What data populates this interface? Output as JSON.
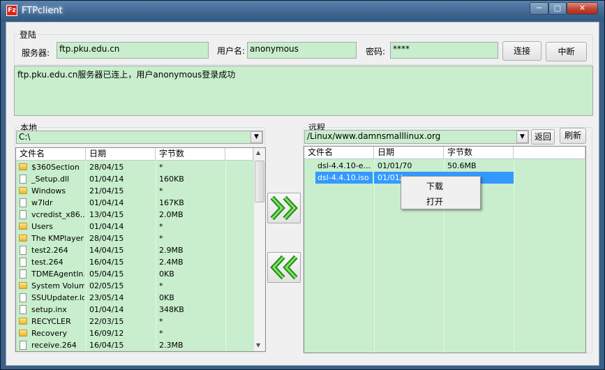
{
  "window": {
    "title": "FTPclient",
    "icon_text": "Fz",
    "min": "─",
    "max": "□",
    "close": "✕"
  },
  "login": {
    "legend": "登陆",
    "server_label": "服务器:",
    "server_value": "ftp.pku.edu.cn",
    "user_label": "用户名:",
    "user_value": "anonymous",
    "password_label": "密码:",
    "password_value": "****",
    "connect_label": "连接",
    "disconnect_label": "中断"
  },
  "log": {
    "message": "ftp.pku.edu.cn服务器已连上，用户anonymous登录成功"
  },
  "local": {
    "legend": "本地",
    "path": "C:\\",
    "columns": [
      "文件名",
      "日期",
      "字节数"
    ],
    "files": [
      {
        "name": "$360Section",
        "date": "28/04/15",
        "size": "*",
        "icon": "folder-icon"
      },
      {
        "name": "_Setup.dll",
        "date": "01/04/14",
        "size": "160KB",
        "icon": "file-icon"
      },
      {
        "name": "Windows",
        "date": "21/04/15",
        "size": "*",
        "icon": "folder-icon"
      },
      {
        "name": "w7ldr",
        "date": "01/04/14",
        "size": "167KB",
        "icon": "file-icon"
      },
      {
        "name": "vcredist_x86....",
        "date": "13/04/15",
        "size": "2.0MB",
        "icon": "file-icon"
      },
      {
        "name": "Users",
        "date": "01/04/14",
        "size": "*",
        "icon": "folder-icon"
      },
      {
        "name": "The KMPlayer",
        "date": "28/04/15",
        "size": "*",
        "icon": "folder-icon"
      },
      {
        "name": "test2.264",
        "date": "14/04/15",
        "size": "2.9MB",
        "icon": "file-icon"
      },
      {
        "name": "test.264",
        "date": "16/04/15",
        "size": "2.4MB",
        "icon": "file-icon"
      },
      {
        "name": "TDMEAgentIn...",
        "date": "05/04/15",
        "size": "0KB",
        "icon": "file-icon"
      },
      {
        "name": "System Volum...",
        "date": "02/05/15",
        "size": "*",
        "icon": "folder-icon"
      },
      {
        "name": "SSUUpdater.log",
        "date": "23/05/14",
        "size": "0KB",
        "icon": "file-icon"
      },
      {
        "name": "setup.inx",
        "date": "01/04/14",
        "size": "348KB",
        "icon": "file-icon"
      },
      {
        "name": "RECYCLER",
        "date": "22/03/15",
        "size": "*",
        "icon": "folder-icon"
      },
      {
        "name": "Recovery",
        "date": "16/09/12",
        "size": "*",
        "icon": "folder-icon"
      },
      {
        "name": "receive.264",
        "date": "16/04/15",
        "size": "2.3MB",
        "icon": "file-icon"
      }
    ]
  },
  "transfer": {
    "upload_icon": "double-chevron-right-icon",
    "download_icon": "double-chevron-left-icon"
  },
  "remote": {
    "legend": "远程",
    "path": "/Linux/www.damnsmalllinux.org",
    "back_label": "返回",
    "refresh_label": "刷新",
    "columns": [
      "文件名",
      "日期",
      "字节数"
    ],
    "files": [
      {
        "name": "dsl-4.4.10-e...",
        "date": "01/01/70",
        "size": "50.6MB",
        "selected": false
      },
      {
        "name": "dsl-4.4.10.iso",
        "date": "01/01/",
        "size": "",
        "selected": true
      }
    ]
  },
  "context_menu": {
    "items": [
      "下载",
      "打开"
    ]
  },
  "colors": {
    "field_bg": "#c8eecd",
    "selection": "#3399ff",
    "titlebar": "#3f6792"
  }
}
